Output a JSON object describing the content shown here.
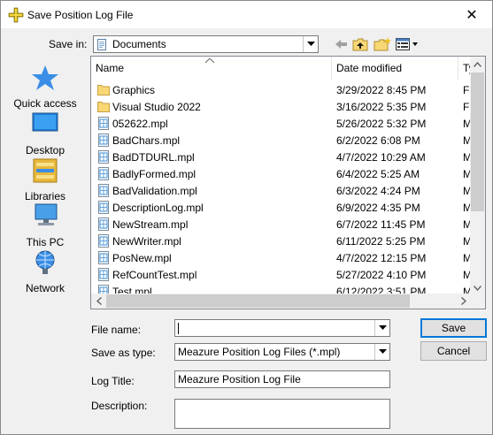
{
  "window": {
    "title": "Save Position Log File",
    "close_glyph": "✕"
  },
  "toolbar": {
    "save_in_label": "Save in:",
    "save_in_value": "Documents",
    "icons": [
      "back-arrow-icon",
      "up-folder-icon",
      "new-folder-icon",
      "view-menu-icon"
    ]
  },
  "places": [
    {
      "label": "Quick access",
      "icon": "star-icon"
    },
    {
      "label": "Desktop",
      "icon": "desktop-icon"
    },
    {
      "label": "Libraries",
      "icon": "libraries-icon"
    },
    {
      "label": "This PC",
      "icon": "computer-icon"
    },
    {
      "label": "Network",
      "icon": "network-icon"
    }
  ],
  "file_list": {
    "columns": [
      "Name",
      "Date modified",
      "Ty"
    ],
    "rows": [
      {
        "kind": "folder",
        "name": "Graphics",
        "date": "3/29/2022 8:45 PM",
        "type": "Fil"
      },
      {
        "kind": "folder",
        "name": "Visual Studio 2022",
        "date": "3/16/2022 5:35 PM",
        "type": "Fil"
      },
      {
        "kind": "file",
        "name": "052622.mpl",
        "date": "5/26/2022 5:32 PM",
        "type": "M"
      },
      {
        "kind": "file",
        "name": "BadChars.mpl",
        "date": "6/2/2022 6:08 PM",
        "type": "M"
      },
      {
        "kind": "file",
        "name": "BadDTDURL.mpl",
        "date": "4/7/2022 10:29 AM",
        "type": "M"
      },
      {
        "kind": "file",
        "name": "BadlyFormed.mpl",
        "date": "6/4/2022 5:25 AM",
        "type": "M"
      },
      {
        "kind": "file",
        "name": "BadValidation.mpl",
        "date": "6/3/2022 4:24 PM",
        "type": "M"
      },
      {
        "kind": "file",
        "name": "DescriptionLog.mpl",
        "date": "6/9/2022 4:35 PM",
        "type": "M"
      },
      {
        "kind": "file",
        "name": "NewStream.mpl",
        "date": "6/7/2022 11:45 PM",
        "type": "M"
      },
      {
        "kind": "file",
        "name": "NewWriter.mpl",
        "date": "6/11/2022 5:25 PM",
        "type": "M"
      },
      {
        "kind": "file",
        "name": "PosNew.mpl",
        "date": "4/7/2022 12:15 PM",
        "type": "M"
      },
      {
        "kind": "file",
        "name": "RefCountTest.mpl",
        "date": "5/27/2022 4:10 PM",
        "type": "M"
      },
      {
        "kind": "file",
        "name": "Test.mpl",
        "date": "6/12/2022 3:51 PM",
        "type": "M"
      }
    ]
  },
  "form": {
    "file_name_label": "File name:",
    "file_name_value": "",
    "save_as_type_label": "Save as type:",
    "save_as_type_value": "Meazure Position Log Files (*.mpl)",
    "log_title_label": "Log Title:",
    "log_title_value": "Meazure Position Log File",
    "description_label": "Description:",
    "description_value": ""
  },
  "buttons": {
    "save": "Save",
    "cancel": "Cancel"
  },
  "colors": {
    "folder": "#f8d775",
    "accent": "#0078d7",
    "file_icon": "#3c8fd8"
  }
}
